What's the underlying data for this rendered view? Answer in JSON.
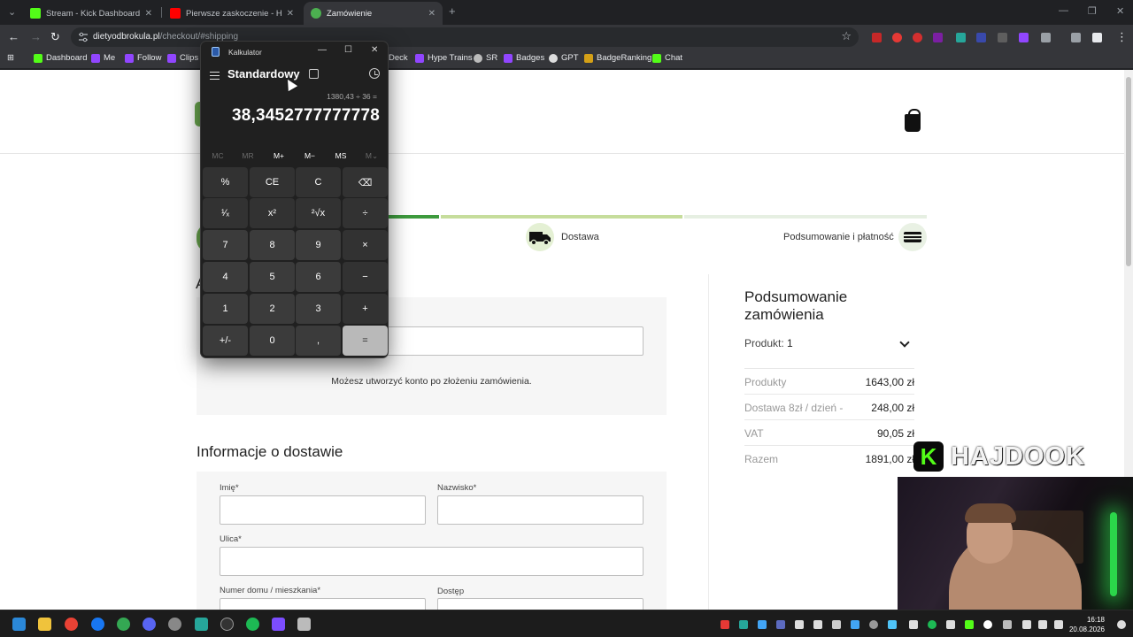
{
  "browser": {
    "tabs": [
      {
        "title": "Stream - Kick Dashboard",
        "active": false,
        "icon": "kick-icon"
      },
      {
        "title": "Pierwsze zaskoczenie - Hradec",
        "active": false,
        "icon": "youtube-icon"
      },
      {
        "title": "Zamówienie",
        "active": true,
        "icon": "broccoli-icon"
      }
    ],
    "new_tab": "+",
    "url_host": "dietyodbrokula.pl",
    "url_path": "/checkout/#shipping",
    "bookmarks": [
      "Dashboard",
      "Me",
      "Follow",
      "Clips",
      "Deck",
      "Hype Trains",
      "SR",
      "Badges",
      "GPT",
      "BadgeRanking",
      "Chat"
    ]
  },
  "calculator": {
    "window_title": "Kalkulator",
    "mode": "Standardowy",
    "expression": "1380,43 ÷ 36 =",
    "result": "38,3452777777778",
    "memory": [
      "MC",
      "MR",
      "M+",
      "M−",
      "MS",
      "M⌄"
    ],
    "keys": [
      [
        "%",
        "CE",
        "C",
        "⌫"
      ],
      [
        "¹⁄ₓ",
        "x²",
        "²√x",
        "÷"
      ],
      [
        "7",
        "8",
        "9",
        "×"
      ],
      [
        "4",
        "5",
        "6",
        "−"
      ],
      [
        "1",
        "2",
        "3",
        "+"
      ],
      [
        "+/-",
        "0",
        ",",
        "="
      ]
    ]
  },
  "checkout": {
    "steps": [
      {
        "label": "Dostawa",
        "icon": "truck-icon"
      },
      {
        "label": "Podsumowanie i płatność",
        "icon": "card-icon"
      }
    ],
    "section_letter": "A",
    "account_note": "Możesz utworzyć konto po złożeniu zamówienia.",
    "shipping_title": "Informacje o dostawie",
    "fields": {
      "first_name": "Imię*",
      "last_name": "Nazwisko*",
      "street": "Ulica*",
      "house_number": "Numer domu / mieszkania*",
      "access": "Dostęp"
    },
    "summary": {
      "title": "Podsumowanie zamówienia",
      "product_label": "Produkt:",
      "product_count": "1",
      "rows": [
        {
          "label": "Produkty",
          "value": "1643,00 zł"
        },
        {
          "label": "Dostawa 8zł / dzień -",
          "value": "248,00 zł"
        },
        {
          "label": "VAT",
          "value": "90,05 zł"
        },
        {
          "label": "Razem",
          "value": "1891,00 zł"
        }
      ]
    }
  },
  "overlay": {
    "brand_letter": "K",
    "channel_name": "HAJDOOK"
  },
  "taskbar": {
    "time": "16:18",
    "date": "20.08.2026"
  },
  "colors": {
    "progress_dark": "#3d9a3d",
    "progress_light": "#c6dd9c",
    "progress_rest": "#e6efe2",
    "step_bg": "#e4f0d4",
    "kick_green": "#53fc18"
  }
}
